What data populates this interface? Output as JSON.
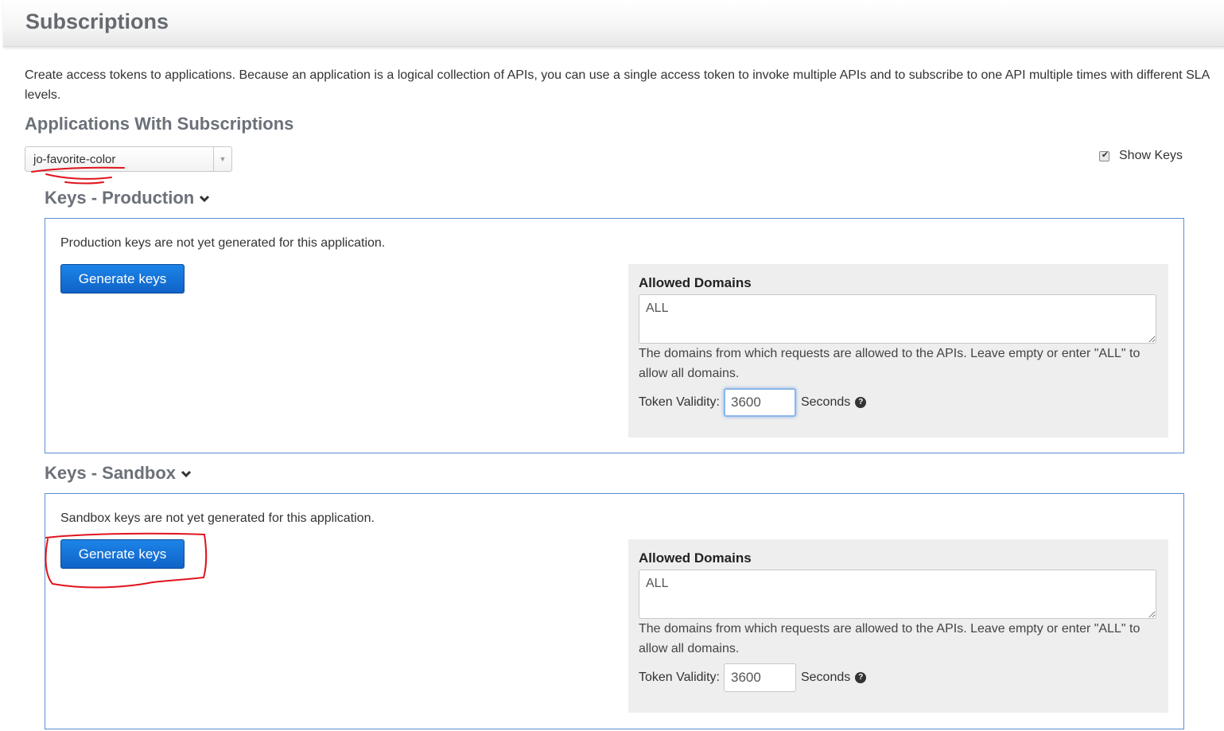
{
  "header": {
    "title": "Subscriptions"
  },
  "intro_text": "Create access tokens to applications. Because an application is a logical collection of APIs, you can use a single access token to invoke multiple APIs and to subscribe to one API multiple times with different SLA levels.",
  "applications": {
    "heading": "Applications With Subscriptions",
    "selected_app": "jo-favorite-color",
    "arrow_icon": "dropdown-arrow-icon"
  },
  "show_keys": {
    "label": "Show Keys",
    "checked": true
  },
  "production": {
    "heading": "Keys - Production",
    "message": "Production keys are not yet generated for this application.",
    "generate_label": "Generate keys",
    "allowed_domains_label": "Allowed Domains",
    "allowed_domains_value": "ALL",
    "domains_help": "The domains from which requests are allowed to the APIs. Leave empty or enter \"ALL\" to allow all domains.",
    "token_validity_label": "Token Validity:",
    "token_validity_value": "3600",
    "seconds_label": "Seconds"
  },
  "sandbox": {
    "heading": "Keys - Sandbox",
    "message": "Sandbox keys are not yet generated for this application.",
    "generate_label": "Generate keys",
    "allowed_domains_label": "Allowed Domains",
    "allowed_domains_value": "ALL",
    "domains_help": "The domains from which requests are allowed to the APIs. Leave empty or enter \"ALL\" to allow all domains.",
    "token_validity_label": "Token Validity:",
    "token_validity_value": "3600",
    "seconds_label": "Seconds"
  },
  "colors": {
    "button": "#1272d6",
    "box_border": "#5b8fd0",
    "heading": "#6b7079",
    "annotation": "#e0141e"
  }
}
